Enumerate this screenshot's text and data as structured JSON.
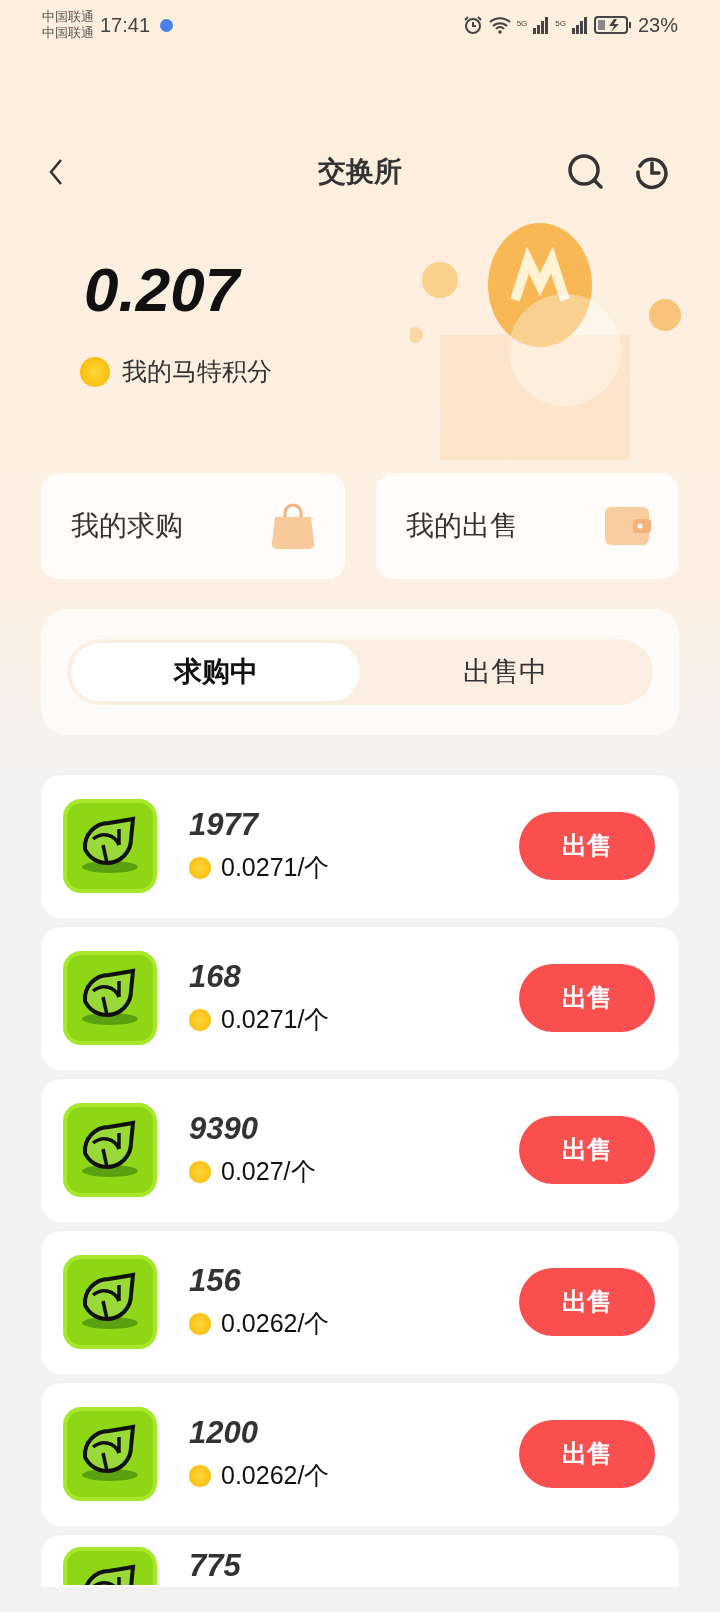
{
  "status_bar": {
    "carrier_1": "中国联通",
    "carrier_2": "中国联通",
    "time": "17:41",
    "network_1": "5G",
    "network_2": "5G",
    "battery": "23%"
  },
  "header": {
    "title": "交换所"
  },
  "balance": {
    "value": "0.207",
    "label": "我的马特积分"
  },
  "shortcuts": [
    {
      "label": "我的求购",
      "kind": "bag"
    },
    {
      "label": "我的出售",
      "kind": "wallet"
    }
  ],
  "tabs": [
    {
      "label": "求购中",
      "selected": true
    },
    {
      "label": "出售中",
      "selected": false
    }
  ],
  "orders": [
    {
      "quantity": "1977",
      "price": "0.0271/个",
      "action": "出售"
    },
    {
      "quantity": "168",
      "price": "0.0271/个",
      "action": "出售"
    },
    {
      "quantity": "9390",
      "price": "0.027/个",
      "action": "出售"
    },
    {
      "quantity": "156",
      "price": "0.0262/个",
      "action": "出售"
    },
    {
      "quantity": "1200",
      "price": "0.0262/个",
      "action": "出售"
    },
    {
      "quantity": "775"
    }
  ]
}
